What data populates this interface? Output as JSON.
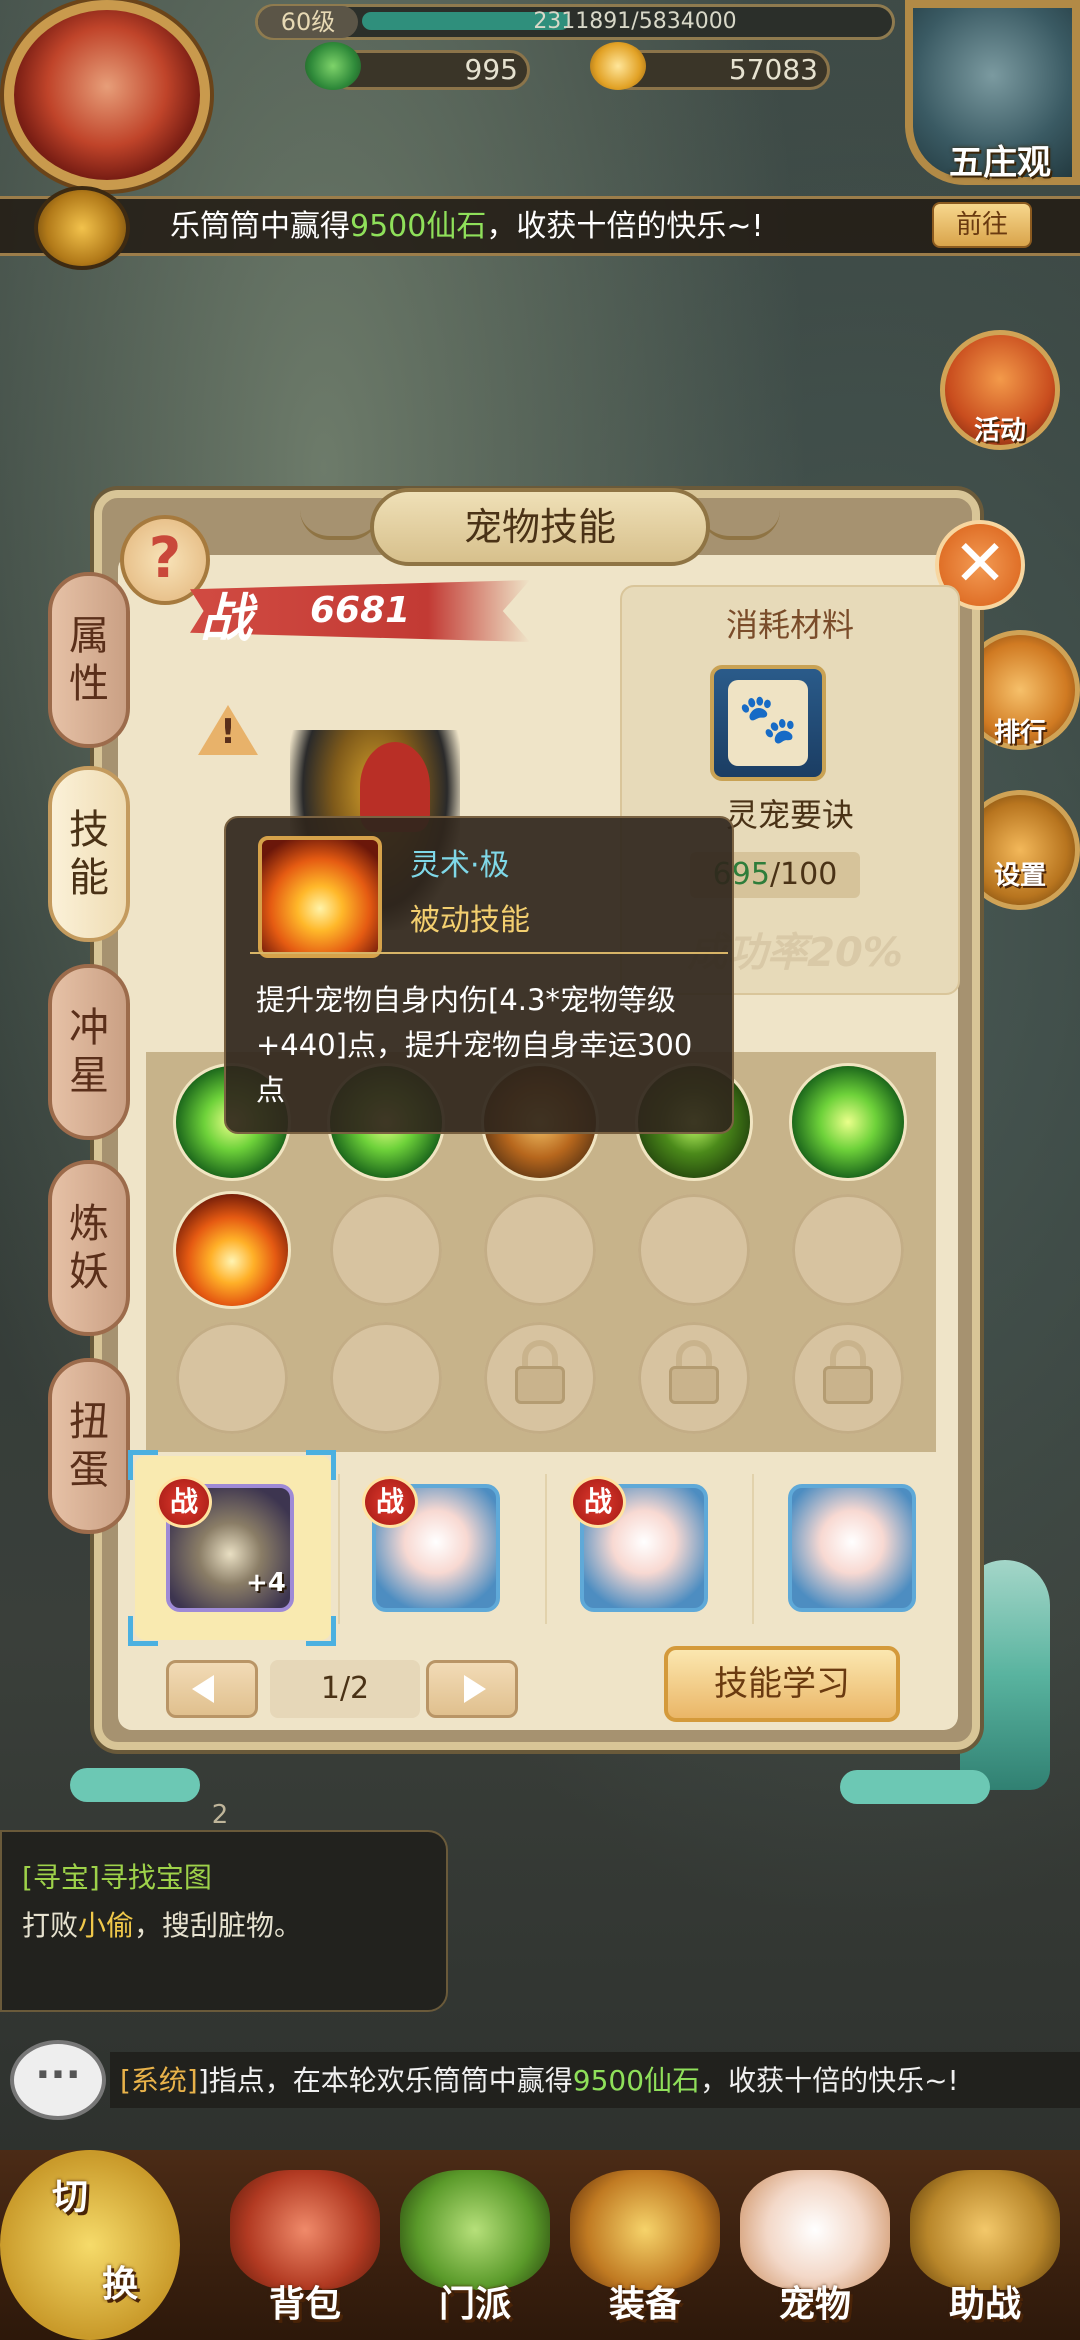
{
  "hud": {
    "level": "60级",
    "exp_text": "2311891/5834000",
    "exp_fraction": 0.396,
    "jade": "995",
    "gold": "57083",
    "map_name": "五庄观"
  },
  "broadcast": {
    "text_prefix": "乐筒筒中赢得",
    "text_highlight": "9500仙石",
    "text_suffix": "，收获十倍的快乐~!",
    "goto_label": "前往"
  },
  "side_buttons": {
    "activity": "活动",
    "ranking": "排行",
    "settings": "设置"
  },
  "panel": {
    "title": "宠物技能",
    "help": "?",
    "close": "✕"
  },
  "tabs": [
    {
      "line1": "属",
      "line2": "性"
    },
    {
      "line1": "技",
      "line2": "能"
    },
    {
      "line1": "冲",
      "line2": "星"
    },
    {
      "line1": "炼",
      "line2": "妖"
    },
    {
      "line1": "扭",
      "line2": "蛋"
    }
  ],
  "power": {
    "glyph": "战",
    "value": "6681"
  },
  "material": {
    "title": "消耗材料",
    "name": "灵宠要诀",
    "have": "695",
    "need": "/100",
    "rate": "成功率20%",
    "icon": "paw-icon"
  },
  "tooltip": {
    "name": "灵术·极",
    "type": "被动技能",
    "description": "提升宠物自身内伤[4.3*宠物等级+440]点，提升宠物自身幸运300点"
  },
  "skills": {
    "row1": [
      "green-burst",
      "green-leaf",
      "earth-beast",
      "dark-thorn",
      "green-slash"
    ],
    "row2": [
      "fire-burst",
      "empty",
      "empty",
      "empty",
      "empty"
    ],
    "row3": [
      "empty",
      "empty",
      "locked",
      "locked",
      "locked"
    ]
  },
  "pets": [
    {
      "badge": "战",
      "level": "+4",
      "kind": "skull-warrior"
    },
    {
      "badge": "战",
      "kind": "white-hair-girl"
    },
    {
      "badge": "战",
      "kind": "white-hair-girl"
    },
    {
      "kind": "white-hair-girl"
    }
  ],
  "pager": {
    "text": "1/2"
  },
  "learn_label": "技能学习",
  "quest": {
    "tab": "2",
    "title": "[寻宝]寻找宝图",
    "desc_prefix": "打败",
    "desc_highlight": "小偷",
    "desc_suffix": "，搜刮脏物。"
  },
  "chat": {
    "tag": "[系统]",
    "text_prefix": "]指点，在本轮欢乐筒筒中赢得",
    "text_highlight": "9500仙石",
    "text_suffix": "，收获十倍的快乐~!"
  },
  "bottom_nav": {
    "switch_top": "切",
    "switch_bottom": "换",
    "items": [
      "背包",
      "门派",
      "装备",
      "宠物",
      "助战"
    ]
  },
  "colors": {
    "accent_red": "#c23a34",
    "highlight_green": "#8fe05a",
    "panel_bg": "#efe4c8"
  }
}
